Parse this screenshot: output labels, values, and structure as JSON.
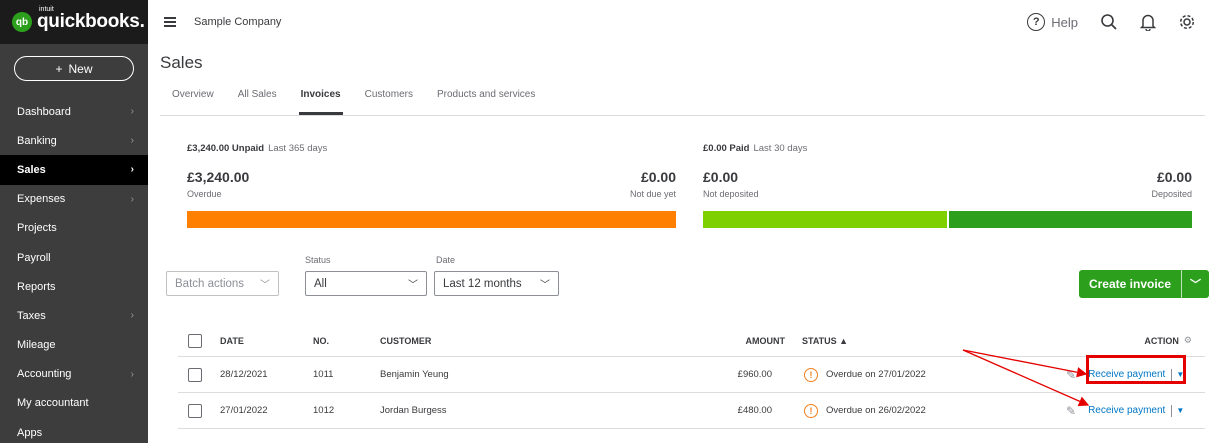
{
  "sidebar": {
    "logo_mark": "qb",
    "logo_small": "intuit",
    "logo_name": "quickbooks.",
    "new_label": "New",
    "items": [
      {
        "label": "Dashboard",
        "chevron": true
      },
      {
        "label": "Banking",
        "chevron": true
      },
      {
        "label": "Sales",
        "chevron": true,
        "active": true
      },
      {
        "label": "Expenses",
        "chevron": true
      },
      {
        "label": "Projects",
        "chevron": false
      },
      {
        "label": "Payroll",
        "chevron": false
      },
      {
        "label": "Reports",
        "chevron": false
      },
      {
        "label": "Taxes",
        "chevron": true
      },
      {
        "label": "Mileage",
        "chevron": false
      },
      {
        "label": "Accounting",
        "chevron": true
      },
      {
        "label": "My accountant",
        "chevron": false
      },
      {
        "label": "Apps",
        "chevron": false
      }
    ]
  },
  "topbar": {
    "company": "Sample Company",
    "help_label": "Help",
    "help_icon": "question-circle-icon"
  },
  "page": {
    "title": "Sales",
    "tabs": [
      "Overview",
      "All Sales",
      "Invoices",
      "Customers",
      "Products and services"
    ],
    "active_tab": "Invoices"
  },
  "summary": {
    "unpaid_head": "£3,240.00 Unpaid",
    "unpaid_period": "Last 365 days",
    "overdue_amount": "£3,240.00",
    "overdue_label": "Overdue",
    "not_due_amount": "£0.00",
    "not_due_label": "Not due yet",
    "paid_head": "£0.00 Paid",
    "paid_period": "Last 30 days",
    "not_deposited_amount": "£0.00",
    "not_deposited_label": "Not deposited",
    "deposited_amount": "£0.00",
    "deposited_label": "Deposited",
    "colors": {
      "overdue": "#ff8000",
      "not_deposited": "#7fd000",
      "deposited": "#2ca01c"
    }
  },
  "filters": {
    "batch_label": "Batch actions",
    "status_label": "Status",
    "status_value": "All",
    "date_label": "Date",
    "date_value": "Last 12 months",
    "create_label": "Create invoice"
  },
  "table": {
    "headers": {
      "date": "DATE",
      "no": "NO.",
      "customer": "CUSTOMER",
      "amount": "AMOUNT",
      "status": "STATUS ▲",
      "action": "ACTION"
    },
    "rows": [
      {
        "date": "28/12/2021",
        "no": "1011",
        "customer": "Benjamin Yeung",
        "amount": "£960.00",
        "status": "Overdue on 27/01/2022",
        "action": "Receive payment"
      },
      {
        "date": "27/01/2022",
        "no": "1012",
        "customer": "Jordan Burgess",
        "amount": "£480.00",
        "status": "Overdue on 26/02/2022",
        "action": "Receive payment"
      }
    ]
  },
  "annotation_color": "#e50000"
}
